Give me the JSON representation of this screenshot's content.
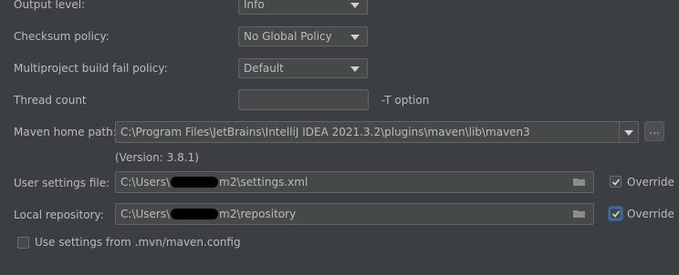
{
  "output_level": {
    "label": "Output level:",
    "value": "Info"
  },
  "checksum_policy": {
    "label": "Checksum policy:",
    "value": "No Global Policy"
  },
  "multiproject_fail_policy": {
    "label": "Multiproject build fail policy:",
    "value": "Default"
  },
  "thread_count": {
    "label": "Thread count",
    "value": "",
    "hint": "-T option"
  },
  "maven_home": {
    "label": "Maven home path:",
    "value": "C:\\Program Files\\JetBrains\\IntelliJ IDEA 2021.3.2\\plugins\\maven\\lib\\maven3",
    "browse_label": "...",
    "version": "(Version: 3.8.1)"
  },
  "user_settings": {
    "label": "User settings file:",
    "value_prefix": "C:\\Users\\",
    "value_suffix": "m2\\settings.xml",
    "override_label": "Override",
    "override_checked": true
  },
  "local_repository": {
    "label": "Local repository:",
    "value_prefix": "C:\\Users\\",
    "value_suffix": "m2\\repository",
    "override_label": "Override",
    "override_checked": true
  },
  "use_mvn_config": {
    "label": "Use settings from .mvn/maven.config",
    "checked": false
  },
  "colors": {
    "background": "#3c3f41",
    "field_background": "#45494a",
    "field_border": "#646464",
    "text": "#bbbbbb",
    "focus": "#4b78a8"
  }
}
